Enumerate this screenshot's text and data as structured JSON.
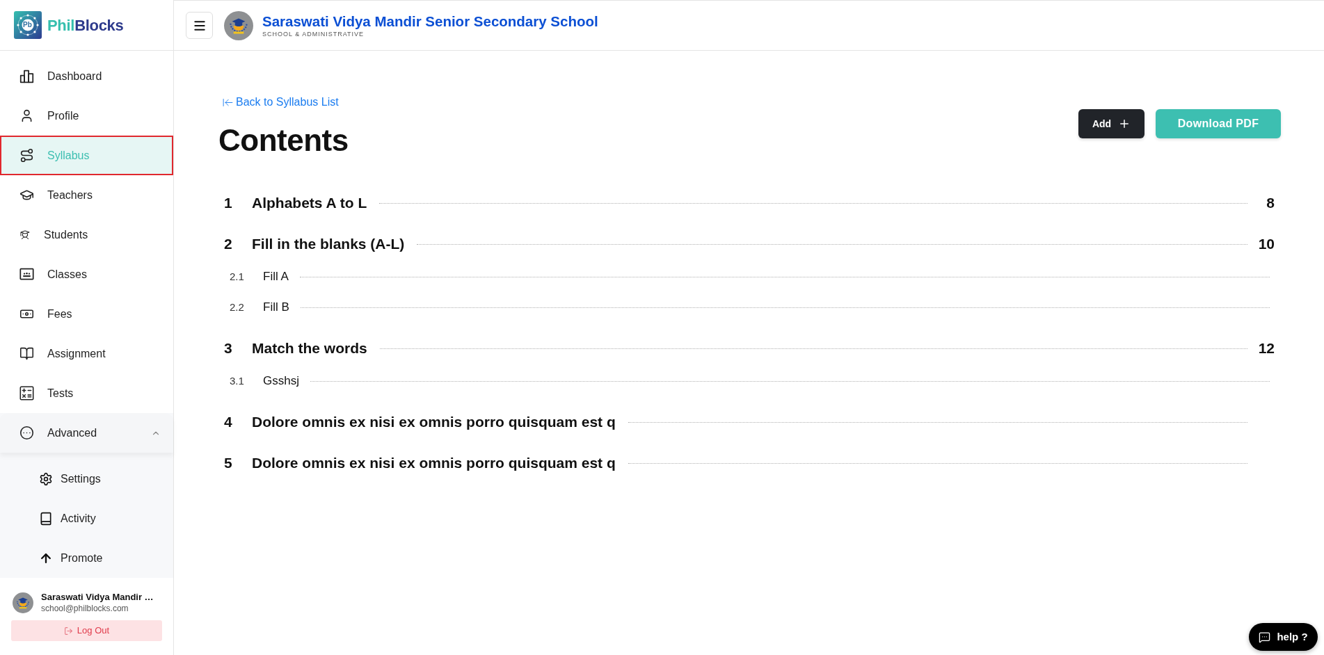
{
  "sidebar": {
    "brand": {
      "mark": "Pb",
      "first": "Phil",
      "second": "Blocks"
    },
    "nav": [
      {
        "label": "Dashboard",
        "selected": false
      },
      {
        "label": "Profile",
        "selected": false
      },
      {
        "label": "Syllabus",
        "selected": true
      },
      {
        "label": "Teachers",
        "selected": false
      },
      {
        "label": "Students",
        "selected": false
      },
      {
        "label": "Classes",
        "selected": false
      },
      {
        "label": "Fees",
        "selected": false
      },
      {
        "label": "Assignment",
        "selected": false
      },
      {
        "label": "Tests",
        "selected": false
      }
    ],
    "advanced": {
      "label": "Advanced",
      "expanded": true,
      "children": [
        {
          "label": "Settings",
          "selected": false
        },
        {
          "label": "Activity",
          "selected": false
        },
        {
          "label": "Promote",
          "selected": false
        }
      ]
    },
    "user": {
      "name": "Saraswati Vidya Mandir …",
      "email": "school@philblocks.com"
    },
    "logout": "Log Out"
  },
  "header": {
    "title": "Saraswati Vidya Mandir Senior Secondary School",
    "subtitle": "SCHOOL & ADMINISTRATIVE"
  },
  "content": {
    "back_link": "Back to Syllabus List",
    "title": "Contents",
    "buttons": {
      "add": "Add",
      "download": "Download PDF"
    },
    "toc": [
      {
        "number": "1",
        "title": "Alphabets A to L",
        "page": "8"
      },
      {
        "number": "2",
        "title": "Fill in the blanks (A-L)",
        "page": "10",
        "children": [
          {
            "number": "2.1",
            "title": "Fill A"
          },
          {
            "number": "2.2",
            "title": "Fill B"
          }
        ]
      },
      {
        "number": "3",
        "title": "Match the words",
        "page": "12",
        "children": [
          {
            "number": "3.1",
            "title": "Gsshsj"
          }
        ]
      },
      {
        "number": "4",
        "title": "Dolore omnis ex nisi ex omnis porro quisquam est q"
      },
      {
        "number": "5",
        "title": "Dolore omnis ex nisi ex omnis porro quisquam est q"
      }
    ]
  },
  "help": "help ?"
}
